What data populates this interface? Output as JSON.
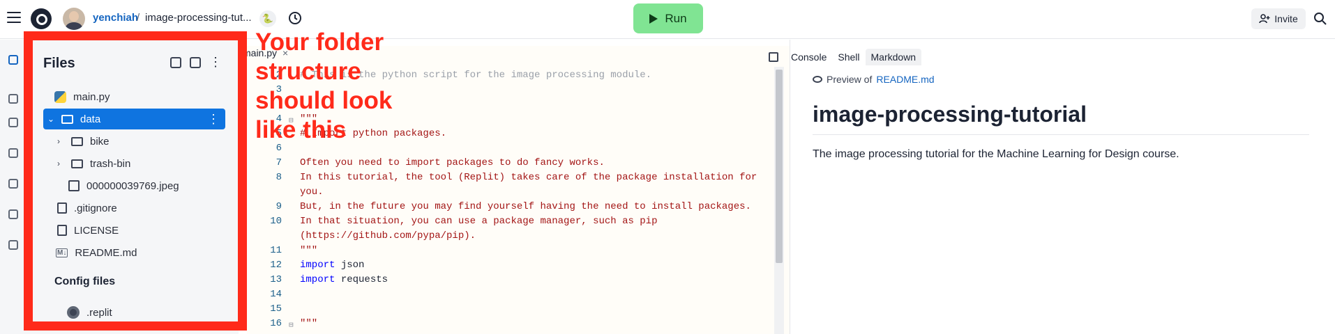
{
  "topbar": {
    "user": "yenchiah",
    "separator": "/",
    "repl_name": "image-processing-tut...",
    "run_label": "Run",
    "invite_label": "Invite"
  },
  "files": {
    "title": "Files",
    "items": [
      {
        "label": "main.py",
        "icon": "python-icon"
      },
      {
        "label": "data",
        "icon": "folder-icon",
        "selected": true
      },
      {
        "label": "bike",
        "icon": "folder-icon"
      },
      {
        "label": "trash-bin",
        "icon": "folder-icon"
      },
      {
        "label": "000000039769.jpeg",
        "icon": "image-icon"
      },
      {
        "label": ".gitignore",
        "icon": "file-icon"
      },
      {
        "label": "LICENSE",
        "icon": "file-icon"
      },
      {
        "label": "README.md",
        "icon": "markdown-icon"
      }
    ],
    "config_title": "Config files",
    "config_items": [
      {
        "label": ".replit",
        "icon": "replit-icon"
      }
    ]
  },
  "annotation": {
    "line1": "Your folder",
    "line2": "structure",
    "line3": "should look",
    "line4": "like this"
  },
  "editor": {
    "tab_label": "main.py",
    "tab_close": "×",
    "lines": [
      {
        "n": "2",
        "text": "# This is the python script for the image processing module."
      },
      {
        "n": "3",
        "text": ""
      },
      {
        "n": "4",
        "text": "\"\"\""
      },
      {
        "n": "5",
        "text": "# Import python packages."
      },
      {
        "n": "6",
        "text": ""
      },
      {
        "n": "7",
        "text": "Often you need to import packages to do fancy works."
      },
      {
        "n": "8",
        "text": "In this tutorial, the tool (Replit) takes care of the package installation for"
      },
      {
        "n": "",
        "text": "you."
      },
      {
        "n": "9",
        "text": "But, in the future you may find yourself having the need to install packages."
      },
      {
        "n": "10",
        "text": "In that situation, you can use a package manager, such as pip"
      },
      {
        "n": "",
        "text": "(https://github.com/pypa/pip)."
      },
      {
        "n": "11",
        "text": "\"\"\""
      },
      {
        "n": "12",
        "kw": "import",
        "rest": " json"
      },
      {
        "n": "13",
        "kw": "import",
        "rest": " requests"
      },
      {
        "n": "14",
        "text": ""
      },
      {
        "n": "15",
        "text": ""
      },
      {
        "n": "16",
        "text": "\"\"\""
      }
    ]
  },
  "right_panel": {
    "tabs": [
      "Console",
      "Shell",
      "Markdown"
    ],
    "active_tab": "Markdown",
    "preview_prefix": "Preview of",
    "preview_file": "README.md",
    "md_title": "image-processing-tutorial",
    "md_body": "The image processing tutorial for the Machine Learning for Design course."
  }
}
